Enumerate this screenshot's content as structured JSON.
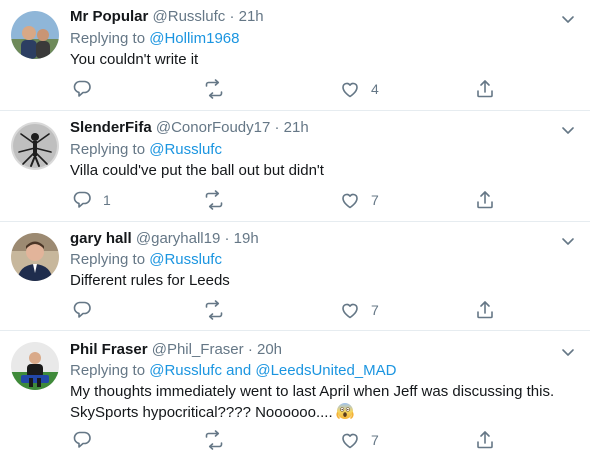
{
  "tweets": [
    {
      "name": "Mr Popular",
      "handle": "@Russlufc",
      "dot": "·",
      "time": "21h",
      "replying_prefix": "Replying to",
      "mentions": [
        "@Hollim1968"
      ],
      "mention_joiner": "",
      "text": "You couldn't write it",
      "reply_count": "",
      "retweet_count": "",
      "like_count": "4",
      "avatar_icon": "avatar-photo"
    },
    {
      "name": "SlenderFifa",
      "handle": "@ConorFoudy17",
      "dot": "·",
      "time": "21h",
      "replying_prefix": "Replying to",
      "mentions": [
        "@Russlufc"
      ],
      "mention_joiner": "",
      "text": "Villa could've put the ball out but didn't",
      "reply_count": "1",
      "retweet_count": "",
      "like_count": "7",
      "avatar_icon": "avatar-photo"
    },
    {
      "name": "gary hall",
      "handle": "@garyhall19",
      "dot": "·",
      "time": "19h",
      "replying_prefix": "Replying to",
      "mentions": [
        "@Russlufc"
      ],
      "mention_joiner": "",
      "text": "Different rules for Leeds",
      "reply_count": "",
      "retweet_count": "",
      "like_count": "7",
      "avatar_icon": "avatar-photo"
    },
    {
      "name": "Phil Fraser",
      "handle": "@Phil_Fraser",
      "dot": "·",
      "time": "20h",
      "replying_prefix": "Replying to",
      "mentions": [
        "@Russlufc",
        "@LeedsUnited_MAD"
      ],
      "mention_joiner": "and",
      "text_line1": "My thoughts immediately went to last April when Jeff was discussing this.",
      "text_line2": "SkySports hypocritical???? Noooooo....",
      "emoji": "face-screaming-in-fear",
      "reply_count": "",
      "retweet_count": "",
      "like_count": "7",
      "avatar_icon": "avatar-photo"
    }
  ],
  "icons": {
    "reply": "reply-icon",
    "retweet": "retweet-icon",
    "like": "heart-icon",
    "share": "share-icon",
    "more": "chevron-down-icon"
  },
  "colors": {
    "name": "#14171a",
    "secondary": "#657786",
    "link": "#1b95e0",
    "divider": "#e6ecf0"
  }
}
